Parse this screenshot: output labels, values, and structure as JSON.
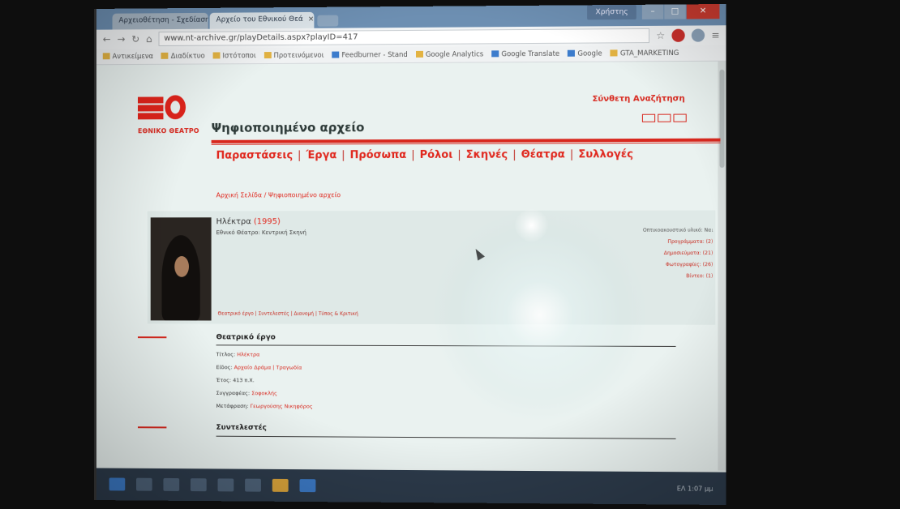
{
  "browser": {
    "tabs": [
      {
        "label": "Αρχειοθέτηση - Σχεδίαση"
      },
      {
        "label": "Αρχείο του Εθνικού Θεά"
      }
    ],
    "user_label": "Χρήστης",
    "url": "www.nt-archive.gr/playDetails.aspx?playID=417",
    "bookmarks": [
      "Αντικείμενα",
      "Διαδίκτυο",
      "Ιστότοποι",
      "Προτεινόμενοι",
      "Feedburner - Stand",
      "Google Analytics",
      "Google Translate",
      "Google",
      "GTA_MARKETING"
    ]
  },
  "site": {
    "brand": "ΕΘΝΙΚΟ ΘΕΑΤΡΟ",
    "heading": "Ψηφιοποιημένο αρχείο",
    "advanced_search": "Σύνθετη Αναζήτηση",
    "menu": [
      "Παραστάσεις",
      "Έργα",
      "Πρόσωπα",
      "Ρόλοι",
      "Σκηνές",
      "Θέατρα",
      "Συλλογές"
    ],
    "breadcrumb": "Αρχική Σελίδα / Ψηφιοποιημένο αρχείο",
    "work": {
      "title": "Ηλέκτρα",
      "year": "(1995)",
      "subtitle": "Εθνικό Θέατρο: Κεντρική Σκηνή",
      "links": "Θεατρικό έργο | Συντελεστές | Διανομή | Τύπος & Κριτική"
    },
    "stats": [
      "Οπτικοακουστικό υλικό: Ναι",
      "Προγράμματα: (2)",
      "Δημοσιεύματα: (21)",
      "Φωτογραφίες: (26)",
      "Βίντεο: (1)"
    ],
    "section_play": {
      "title": "Θεατρικό έργο",
      "fields": [
        {
          "label": "Τίτλος:",
          "value": "Ηλέκτρα"
        },
        {
          "label": "Είδος:",
          "value": "Αρχαίο Δράμα | Τραγωδία"
        },
        {
          "label": "Έτος:",
          "value": "413 π.Χ."
        },
        {
          "label": "Συγγραφέας:",
          "value": "Σοφοκλής"
        },
        {
          "label": "Μετάφραση:",
          "value": "Γεωργούσης Νικηφόρος"
        }
      ]
    },
    "section_credits": {
      "title": "Συντελεστές"
    }
  },
  "taskbar": {
    "tray_text": "ΕΛ  1:07 μμ"
  }
}
